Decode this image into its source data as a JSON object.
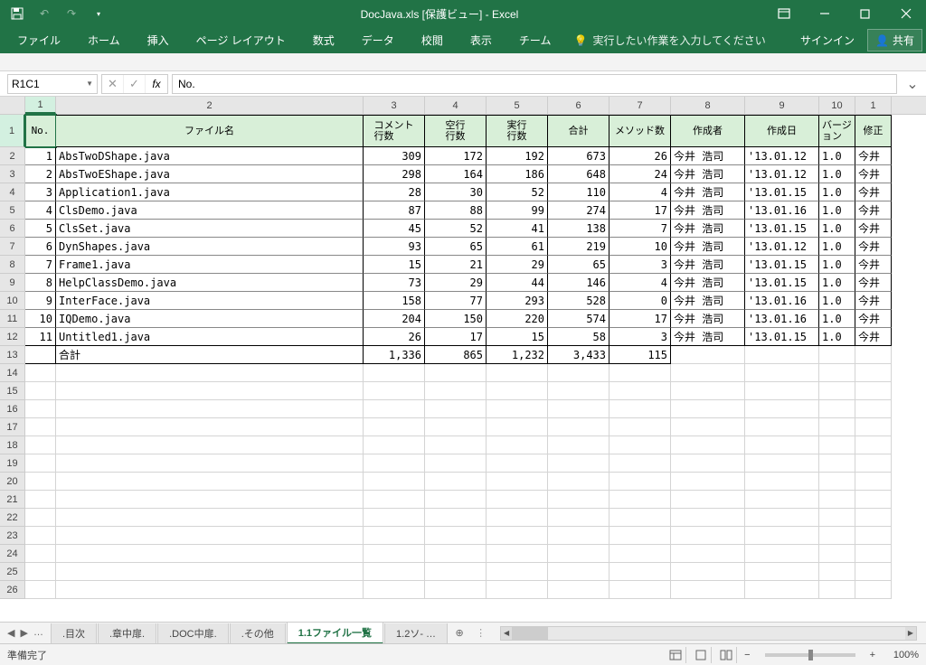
{
  "titlebar": {
    "title": "DocJava.xls  [保護ビュー] - Excel"
  },
  "ribbon": {
    "tabs": [
      "ファイル",
      "ホーム",
      "挿入",
      "ページ レイアウト",
      "数式",
      "データ",
      "校閲",
      "表示",
      "チーム"
    ],
    "tellme": "実行したい作業を入力してください",
    "signin": "サインイン",
    "share": "共有"
  },
  "formula": {
    "name_box": "R1C1",
    "value": "No."
  },
  "columns": [
    "1",
    "2",
    "3",
    "4",
    "5",
    "6",
    "7",
    "8",
    "9",
    "10",
    "1"
  ],
  "headers": [
    "No.",
    "ファイル名",
    "コメント\n行数",
    "空行\n行数",
    "実行\n行数",
    "合計",
    "メソッド数",
    "作成者",
    "作成日",
    "バージョン",
    "修正"
  ],
  "rows": [
    {
      "n": "1",
      "f": "AbsTwoDShape.java",
      "c": "309",
      "b": "172",
      "e": "192",
      "t": "673",
      "m": "26",
      "a": "今井 浩司",
      "d": "'13.01.12",
      "v": "1.0",
      "u": "今井"
    },
    {
      "n": "2",
      "f": "AbsTwoEShape.java",
      "c": "298",
      "b": "164",
      "e": "186",
      "t": "648",
      "m": "24",
      "a": "今井 浩司",
      "d": "'13.01.12",
      "v": "1.0",
      "u": "今井"
    },
    {
      "n": "3",
      "f": "Application1.java",
      "c": "28",
      "b": "30",
      "e": "52",
      "t": "110",
      "m": "4",
      "a": "今井 浩司",
      "d": "'13.01.15",
      "v": "1.0",
      "u": "今井"
    },
    {
      "n": "4",
      "f": "ClsDemo.java",
      "c": "87",
      "b": "88",
      "e": "99",
      "t": "274",
      "m": "17",
      "a": "今井 浩司",
      "d": "'13.01.16",
      "v": "1.0",
      "u": "今井"
    },
    {
      "n": "5",
      "f": "ClsSet.java",
      "c": "45",
      "b": "52",
      "e": "41",
      "t": "138",
      "m": "7",
      "a": "今井 浩司",
      "d": "'13.01.15",
      "v": "1.0",
      "u": "今井"
    },
    {
      "n": "6",
      "f": "DynShapes.java",
      "c": "93",
      "b": "65",
      "e": "61",
      "t": "219",
      "m": "10",
      "a": "今井 浩司",
      "d": "'13.01.12",
      "v": "1.0",
      "u": "今井"
    },
    {
      "n": "7",
      "f": "Frame1.java",
      "c": "15",
      "b": "21",
      "e": "29",
      "t": "65",
      "m": "3",
      "a": "今井 浩司",
      "d": "'13.01.15",
      "v": "1.0",
      "u": "今井"
    },
    {
      "n": "8",
      "f": "HelpClassDemo.java",
      "c": "73",
      "b": "29",
      "e": "44",
      "t": "146",
      "m": "4",
      "a": "今井 浩司",
      "d": "'13.01.15",
      "v": "1.0",
      "u": "今井"
    },
    {
      "n": "9",
      "f": "InterFace.java",
      "c": "158",
      "b": "77",
      "e": "293",
      "t": "528",
      "m": "0",
      "a": "今井 浩司",
      "d": "'13.01.16",
      "v": "1.0",
      "u": "今井"
    },
    {
      "n": "10",
      "f": "IQDemo.java",
      "c": "204",
      "b": "150",
      "e": "220",
      "t": "574",
      "m": "17",
      "a": "今井 浩司",
      "d": "'13.01.16",
      "v": "1.0",
      "u": "今井"
    },
    {
      "n": "11",
      "f": "Untitled1.java",
      "c": "26",
      "b": "17",
      "e": "15",
      "t": "58",
      "m": "3",
      "a": "今井 浩司",
      "d": "'13.01.15",
      "v": "1.0",
      "u": "今井"
    }
  ],
  "total": {
    "label": "合計",
    "c": "1,336",
    "b": "865",
    "e": "1,232",
    "t": "3,433",
    "m": "115"
  },
  "empty_rows": [
    "14",
    "15",
    "16",
    "17",
    "18",
    "19",
    "20",
    "21",
    "22",
    "23",
    "24",
    "25",
    "26"
  ],
  "sheets": {
    "dots": "…",
    "tabs": [
      ".目次",
      ".章中扉.",
      ".DOC中扉.",
      ".その他",
      "1.1ファイル一覧",
      "1.2ソ- …"
    ],
    "active": 4
  },
  "status": {
    "ready": "準備完了",
    "zoom": "100%"
  }
}
